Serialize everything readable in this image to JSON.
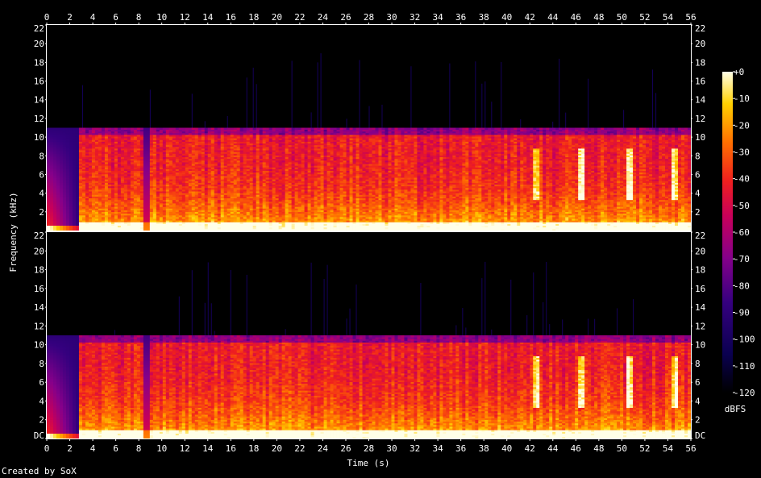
{
  "chart_data": {
    "type": "heatmap",
    "subtype": "spectrogram",
    "channels": 2,
    "xlabel": "Time (s)",
    "ylabel": "Frequency (kHz)",
    "xlim": [
      0,
      56
    ],
    "ylim_khz": [
      0,
      22
    ],
    "x_ticks": [
      0,
      2,
      4,
      6,
      8,
      10,
      12,
      14,
      16,
      18,
      20,
      22,
      24,
      26,
      28,
      30,
      32,
      34,
      36,
      38,
      40,
      42,
      44,
      46,
      48,
      50,
      52,
      54,
      56
    ],
    "y_ticks_top": [
      "22",
      "20",
      "18",
      "16",
      "14",
      "12",
      "10",
      "8",
      "6",
      "4",
      "2"
    ],
    "y_ticks_bottom": [
      "22",
      "20",
      "18",
      "16",
      "14",
      "12",
      "10",
      "8",
      "6",
      "4",
      "2",
      "DC"
    ],
    "y_tick_values": [
      22,
      20,
      18,
      16,
      14,
      12,
      10,
      8,
      6,
      4,
      2,
      0
    ],
    "lowpass_cutoff_khz": 11,
    "quiet_intro_end_s": 2.8,
    "dip_region_s": [
      8.3,
      9.1
    ],
    "bright_band_times_s": [
      42.5,
      46.5,
      50.6,
      54.6
    ],
    "colorbar": {
      "label": "dBFS",
      "ticks": [
        "+0",
        "-10",
        "-20",
        "-30",
        "-40",
        "-50",
        "-60",
        "-70",
        "-80",
        "-90",
        "-100",
        "-110",
        "-120"
      ],
      "range": [
        -120,
        0
      ]
    },
    "colors": {
      "background": "#000000",
      "low": "#000040",
      "mid": "#c0002a",
      "high": "#ffff90"
    }
  },
  "credit": "Created by SoX"
}
